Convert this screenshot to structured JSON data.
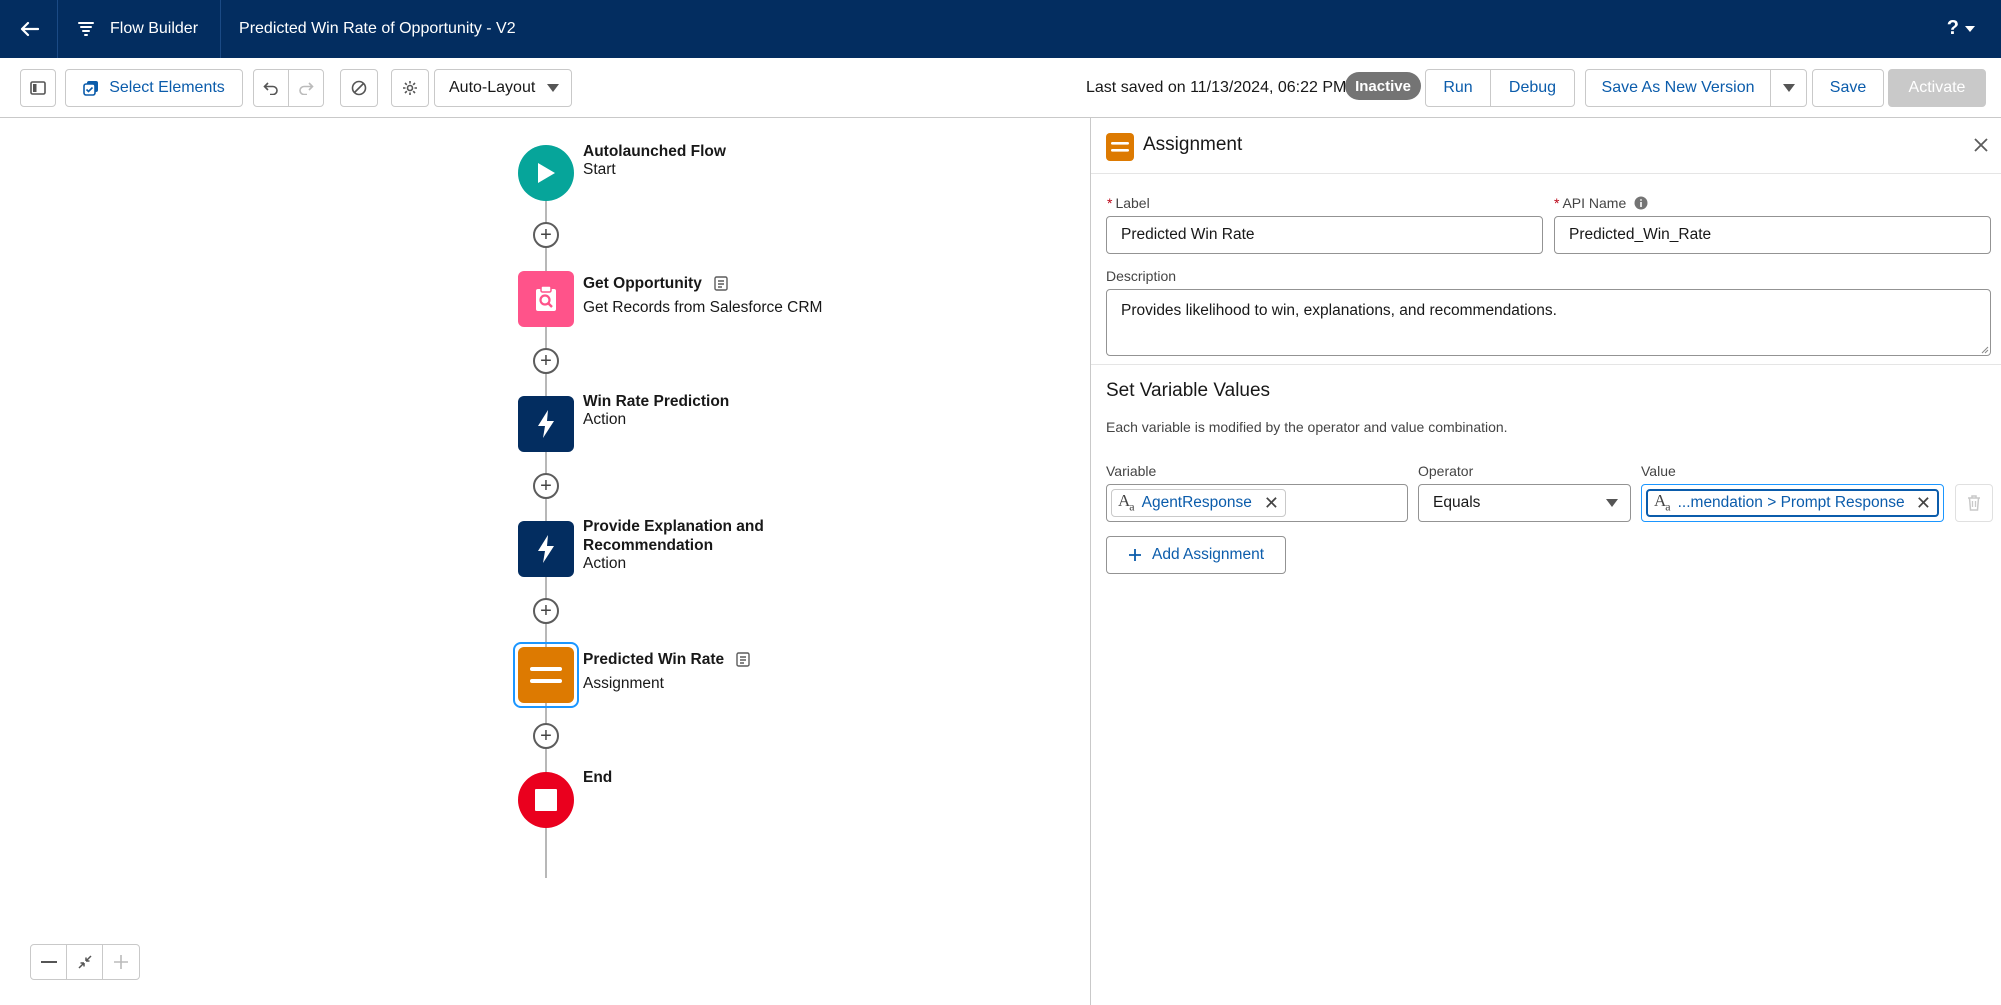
{
  "header": {
    "app_name": "Flow Builder",
    "flow_title": "Predicted Win Rate of Opportunity - V2",
    "help_label": "?"
  },
  "toolbar": {
    "select_elements_label": "Select Elements",
    "layout_select_value": "Auto-Layout",
    "last_saved": "Last saved on 11/13/2024, 06:22 PM",
    "status_badge": "Inactive",
    "run_label": "Run",
    "debug_label": "Debug",
    "save_as_new_version_label": "Save As New Version",
    "save_label": "Save",
    "activate_label": "Activate"
  },
  "canvas": {
    "nodes": [
      {
        "title": "Autolaunched Flow",
        "subtitle": "Start",
        "icon": "play-icon",
        "color": "#06a59a"
      },
      {
        "title": "Get Opportunity",
        "subtitle": "Get Records from Salesforce CRM",
        "icon": "record-lookup-icon",
        "color": "#ff538a"
      },
      {
        "title": "Win Rate Prediction",
        "subtitle": "Action",
        "icon": "lightning-icon",
        "color": "#032d60"
      },
      {
        "title": "Provide Explanation and Recommendation",
        "subtitle": "Action",
        "icon": "lightning-icon",
        "color": "#032d60"
      },
      {
        "title": "Predicted Win Rate",
        "subtitle": "Assignment",
        "icon": "assignment-icon",
        "color": "#dd7a01"
      },
      {
        "title": "End",
        "subtitle": "",
        "icon": "stop-icon",
        "color": "#ea001e"
      }
    ]
  },
  "panel": {
    "title": "Assignment",
    "label_field": {
      "label": "Label",
      "value": "Predicted Win Rate"
    },
    "api_name_field": {
      "label": "API Name",
      "value": "Predicted_Win_Rate"
    },
    "description_field": {
      "label": "Description",
      "value": "Provides likelihood to win, explanations, and recommendations."
    },
    "section_title": "Set Variable Values",
    "section_desc": "Each variable is modified by the operator and value combination.",
    "row": {
      "variable_label": "Variable",
      "variable_value": "AgentResponse",
      "operator_label": "Operator",
      "operator_value": "Equals",
      "value_label": "Value",
      "value_value": "...mendation > Prompt Response"
    },
    "add_assignment_label": "Add Assignment"
  }
}
